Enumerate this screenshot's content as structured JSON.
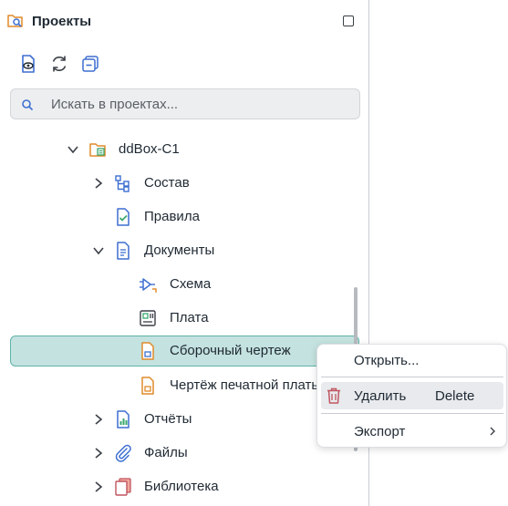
{
  "panel": {
    "title": "Проекты"
  },
  "search": {
    "placeholder": "Искать в проектах..."
  },
  "tree": [
    {
      "label": "ddBox-C1",
      "icon": "project-icon",
      "expanded": true
    },
    {
      "label": "Состав",
      "icon": "hierarchy-icon",
      "expanded": false
    },
    {
      "label": "Правила",
      "icon": "rules-icon"
    },
    {
      "label": "Документы",
      "icon": "documents-icon",
      "expanded": true
    },
    {
      "label": "Схема",
      "icon": "schematic-icon"
    },
    {
      "label": "Плата",
      "icon": "board-icon"
    },
    {
      "label": "Сборочный чертеж",
      "icon": "assembly-drawing-icon",
      "selected": true
    },
    {
      "label": "Чертёж печатной платы",
      "icon": "pcb-drawing-icon"
    },
    {
      "label": "Отчёты",
      "icon": "reports-icon",
      "expanded": false
    },
    {
      "label": "Файлы",
      "icon": "paperclip-icon",
      "expanded": false
    },
    {
      "label": "Библиотека",
      "icon": "library-icon",
      "expanded": false
    }
  ],
  "context_menu": {
    "items": [
      {
        "label": "Открыть..."
      },
      {
        "label": "Удалить",
        "shortcut": "Delete",
        "icon": "trash-icon"
      },
      {
        "label": "Экспорт",
        "submenu": true
      }
    ]
  },
  "colors": {
    "accent": "#3d6fd1",
    "selection_bg": "#c4e2df",
    "selection_border": "#5fb2aa",
    "delete_icon": "#c0555f"
  }
}
